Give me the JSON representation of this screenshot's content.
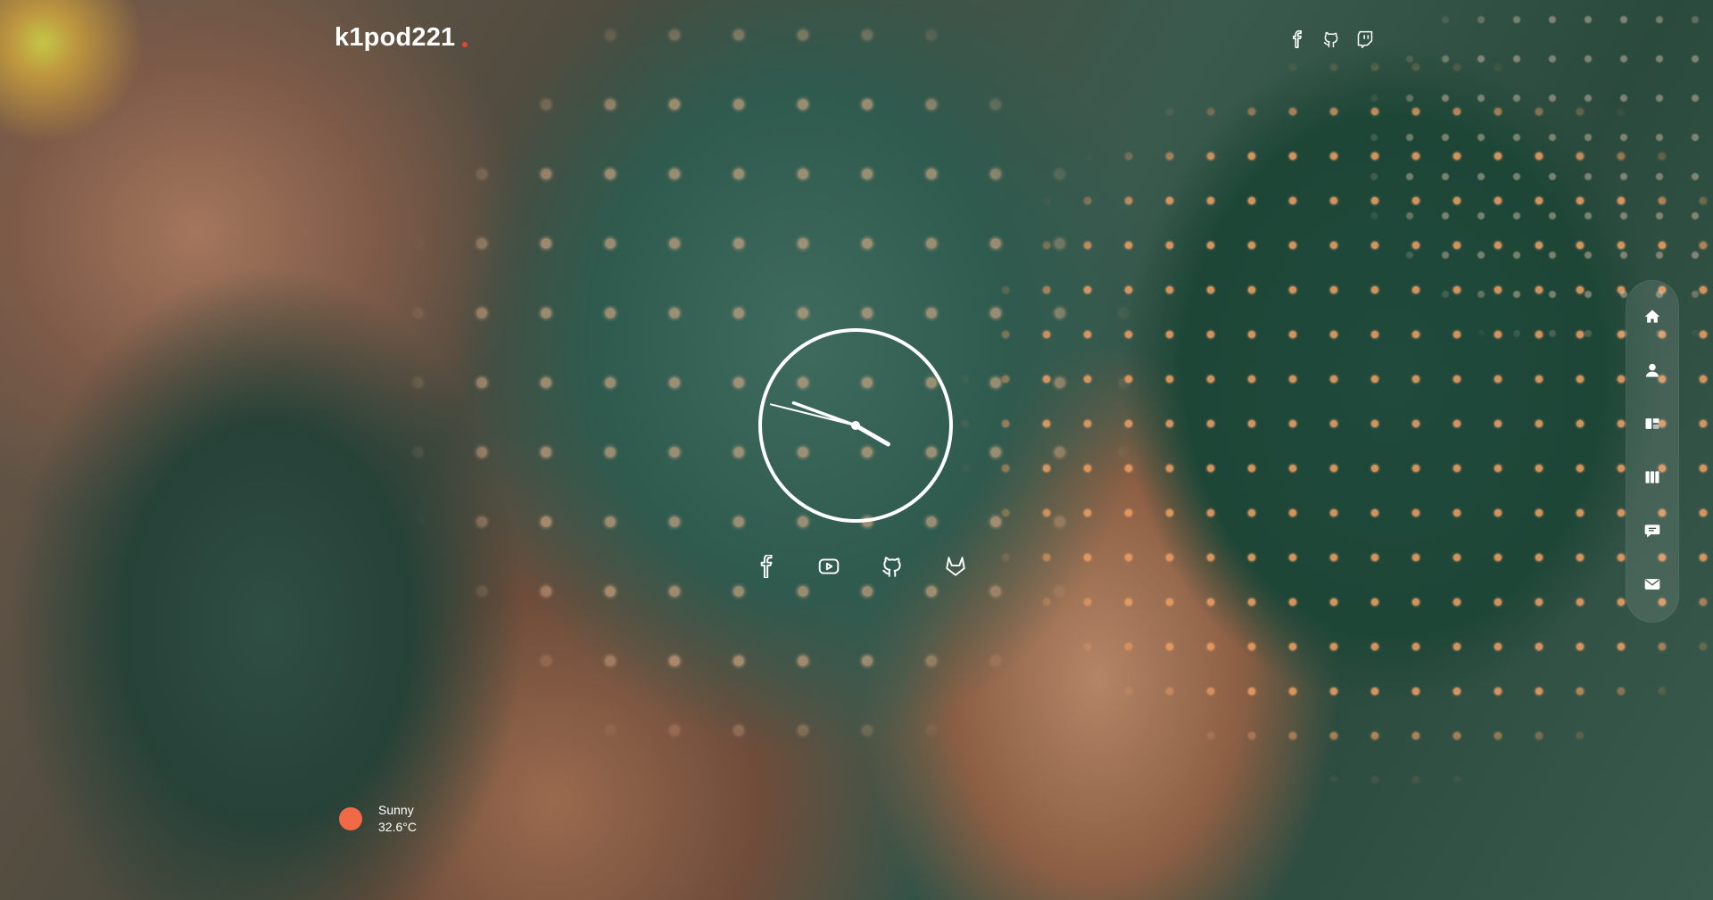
{
  "brand": {
    "name": "k1pod221",
    "accent_color": "#e2482f"
  },
  "header": {
    "social_icons": [
      {
        "icon": "facebook-icon"
      },
      {
        "icon": "github-icon"
      },
      {
        "icon": "twitch-icon"
      }
    ]
  },
  "clock": {
    "type": "analog",
    "hour_hand_angle_deg": 120,
    "minute_hand_angle_deg": -70,
    "second_hand_angle_deg": -76
  },
  "center_social": {
    "icons": [
      {
        "icon": "facebook-icon"
      },
      {
        "icon": "youtube-icon"
      },
      {
        "icon": "github-icon"
      },
      {
        "icon": "gitlab-icon"
      }
    ]
  },
  "side_nav": {
    "items": [
      {
        "icon": "home-icon"
      },
      {
        "icon": "user-icon"
      },
      {
        "icon": "dashboard-icon"
      },
      {
        "icon": "columns-icon"
      },
      {
        "icon": "chat-icon"
      },
      {
        "icon": "mail-icon"
      }
    ]
  },
  "weather": {
    "condition": "Sunny",
    "temperature": "32.6°C",
    "icon_color": "#f06a48"
  }
}
